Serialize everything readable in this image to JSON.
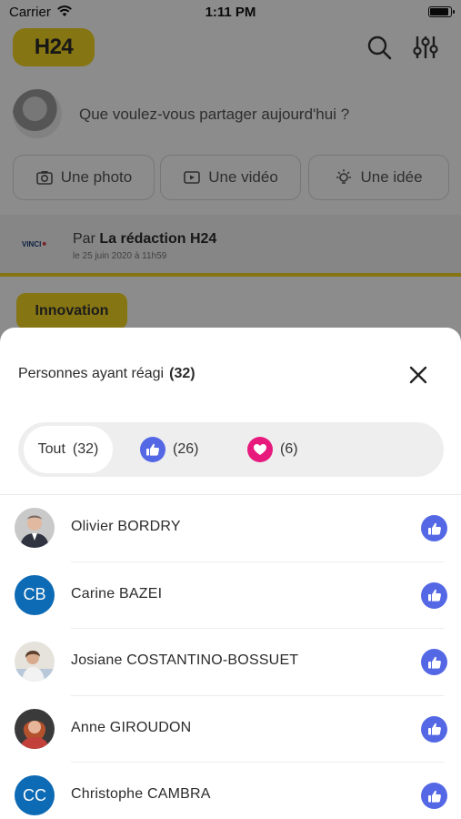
{
  "status_bar": {
    "carrier": "Carrier",
    "time": "1:11 PM",
    "battery_level": 0.95
  },
  "app": {
    "logo": "H24",
    "composer_prompt": "Que voulez-vous partager aujourd'hui ?",
    "actions": [
      {
        "label": "Une photo",
        "icon": "camera-icon"
      },
      {
        "label": "Une vidéo",
        "icon": "video-icon"
      },
      {
        "label": "Une idée",
        "icon": "lightbulb-icon"
      }
    ],
    "post": {
      "by_prefix": "Par",
      "author": "La rédaction H24",
      "date": "le 25 juin 2020 à 11h59",
      "source_logo": {
        "text": "VINCI",
        "mark": "⁕"
      },
      "tag": "Innovation"
    }
  },
  "sheet": {
    "title": "Personnes ayant réagi",
    "total": "(32)",
    "tabs": [
      {
        "label": "Tout",
        "count": "(32)",
        "selected": true
      },
      {
        "icon": "thumbs-up-icon",
        "count": "(26)",
        "selected": false
      },
      {
        "icon": "heart-icon",
        "count": "(6)",
        "selected": false
      }
    ],
    "people": [
      {
        "name": "Olivier BORDRY",
        "avatar": "photo",
        "reaction": "thumbs-up-icon"
      },
      {
        "name": "Carine BAZEI",
        "avatar": "initials",
        "initials": "CB",
        "reaction": "thumbs-up-icon"
      },
      {
        "name": "Josiane COSTANTINO-BOSSUET",
        "avatar": "photo",
        "reaction": "thumbs-up-icon"
      },
      {
        "name": "Anne GIROUDON",
        "avatar": "photo",
        "reaction": "thumbs-up-icon"
      },
      {
        "name": "Christophe CAMBRA",
        "avatar": "initials",
        "initials": "CC",
        "reaction": "thumbs-up-icon"
      }
    ]
  },
  "colors": {
    "accent_yellow": "#f4d623",
    "like_blue": "#5468e5",
    "love_pink": "#e8197d",
    "initials_blue": "#0d6ab4"
  }
}
